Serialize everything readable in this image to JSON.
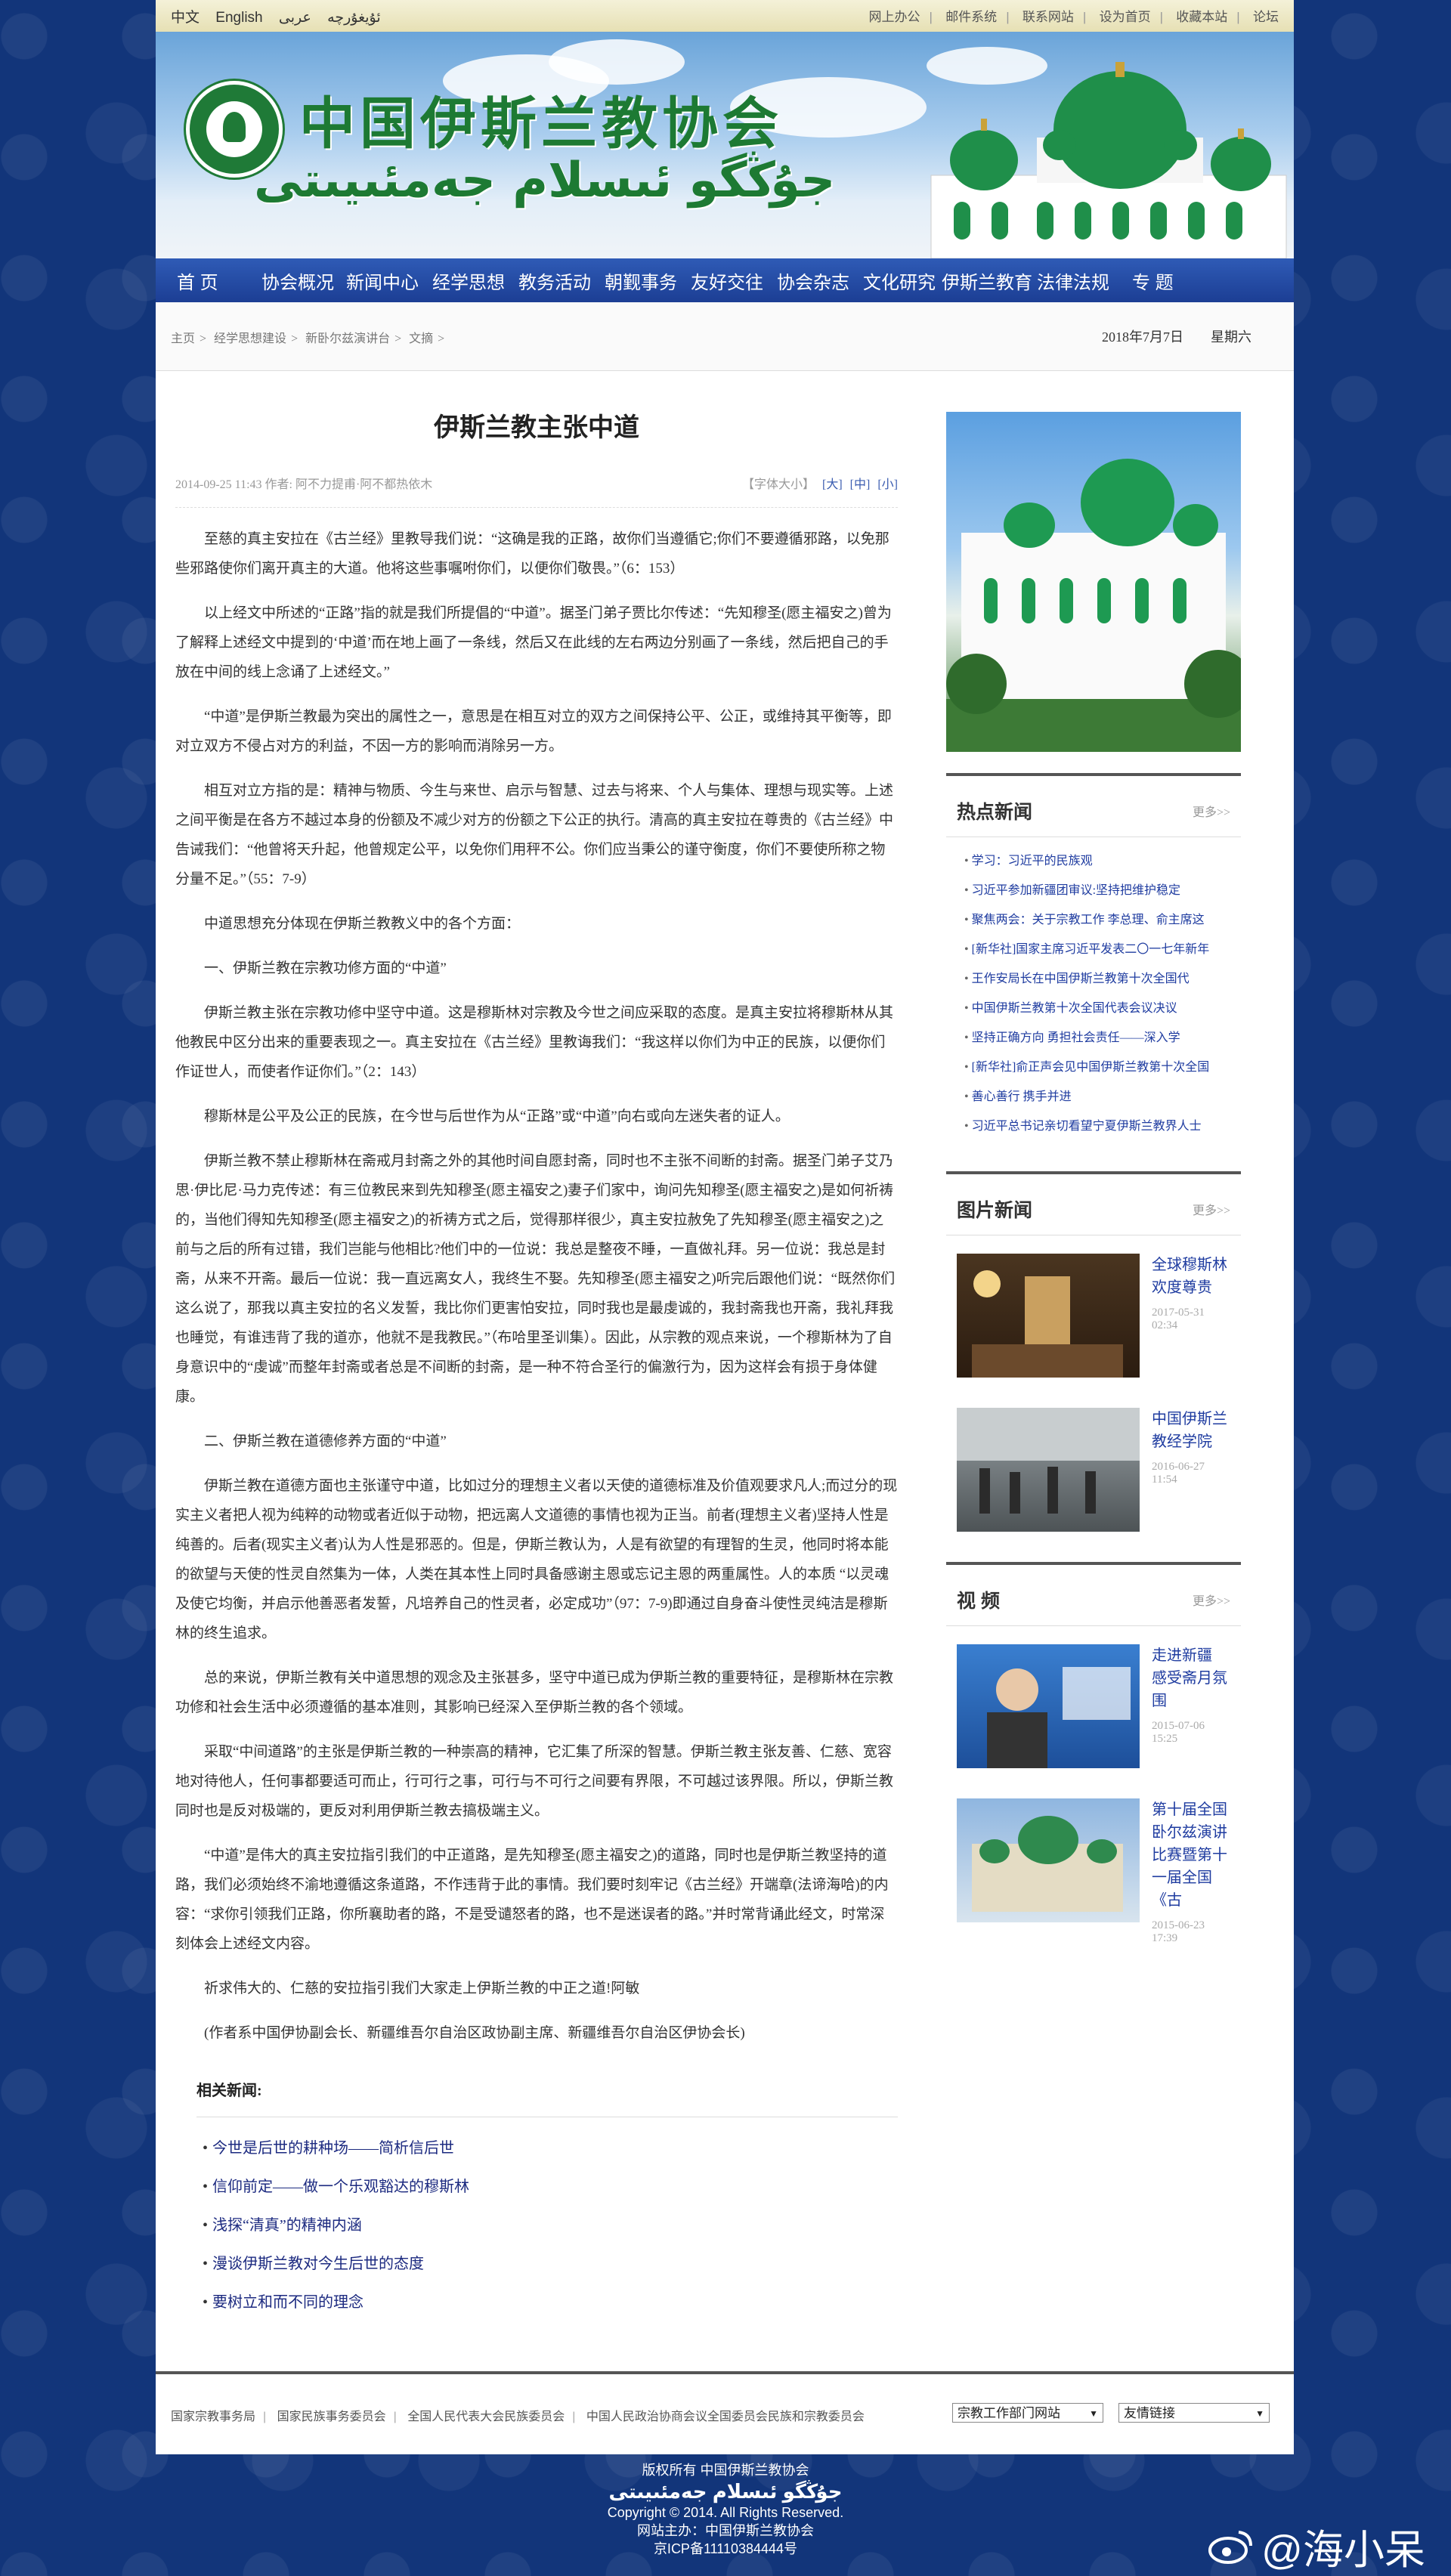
{
  "topbar": {
    "lang": [
      "中文",
      "English",
      "ئۇيغۇرچە",
      "عربى"
    ],
    "links": [
      "网上办公",
      "邮件系统",
      "联系网站",
      "设为首页",
      "收藏本站",
      "论坛"
    ]
  },
  "banner": {
    "cn_title": "中国伊斯兰教协会",
    "ug_title": "جۇڭگو ئىسلام جەمئىيىتى"
  },
  "nav": [
    "首 页",
    "协会概况",
    "新闻中心",
    "经学思想",
    "教务活动",
    "朝觐事务",
    "友好交往",
    "协会杂志",
    "文化研究",
    "伊斯兰教育",
    "法律法规",
    "专 题"
  ],
  "breadcrumb": [
    "主页",
    "经学思想建设",
    "新卧尔兹演讲台",
    "文摘"
  ],
  "date": {
    "date": "2018年7月7日",
    "weekday": "星期六"
  },
  "article": {
    "title": "伊斯兰教主张中道",
    "meta_left": "2014-09-25 11:43 作者: 阿不力提甫·阿不都热依木",
    "size_label": "【字体大小】",
    "sizes": [
      "[大]",
      "[中]",
      "[小]"
    ],
    "paragraphs": [
      "至慈的真主安拉在《古兰经》里教导我们说：“这确是我的正路，故你们当遵循它;你们不要遵循邪路，以免那些邪路使你们离开真主的大道。他将这些事嘱咐你们，以便你们敬畏。”（6：153）",
      "以上经文中所述的“正路”指的就是我们所提倡的“中道”。据圣门弟子贾比尔传述：“先知穆圣(愿主福安之)曾为了解释上述经文中提到的‘中道’而在地上画了一条线，然后又在此线的左右两边分别画了一条线，然后把自己的手放在中间的线上念诵了上述经文。”",
      "“中道”是伊斯兰教最为突出的属性之一，意思是在相互对立的双方之间保持公平、公正，或维持其平衡等，即对立双方不侵占对方的利益，不因一方的影响而消除另一方。",
      "相互对立方指的是：精神与物质、今生与来世、启示与智慧、过去与将来、个人与集体、理想与现实等。上述之间平衡是在各方不越过本身的份额及不减少对方的份额之下公正的执行。清高的真主安拉在尊贵的《古兰经》中告诫我们：“他曾将天升起，他曾规定公平，以免你们用秤不公。你们应当秉公的谨守衡度，你们不要使所称之物分量不足。”（55：7-9）",
      "中道思想充分体现在伊斯兰教教义中的各个方面：",
      "一、伊斯兰教在宗教功修方面的“中道”",
      "伊斯兰教主张在宗教功修中坚守中道。这是穆斯林对宗教及今世之间应采取的态度。是真主安拉将穆斯林从其他教民中区分出来的重要表现之一。真主安拉在《古兰经》里教诲我们：“我这样以你们为中正的民族，以便你们作证世人，而使者作证你们。”（2：143）",
      "穆斯林是公平及公正的民族，在今世与后世作为从“正路”或“中道”向右或向左迷失者的证人。",
      "伊斯兰教不禁止穆斯林在斋戒月封斋之外的其他时间自愿封斋，同时也不主张不间断的封斋。据圣门弟子艾乃思·伊比尼·马力克传述：有三位教民来到先知穆圣(愿主福安之)妻子们家中，询问先知穆圣(愿主福安之)是如何祈祷的，当他们得知先知穆圣(愿主福安之)的祈祷方式之后，觉得那样很少，真主安拉赦免了先知穆圣(愿主福安之)之前与之后的所有过错，我们岂能与他相比?他们中的一位说：我总是整夜不睡，一直做礼拜。另一位说：我总是封斋，从来不开斋。最后一位说：我一直远离女人，我终生不娶。先知穆圣(愿主福安之)听完后跟他们说：“既然你们这么说了，那我以真主安拉的名义发誓，我比你们更害怕安拉，同时我也是最虔诚的，我封斋我也开斋，我礼拜我也睡觉，有谁违背了我的道亦，他就不是我教民。”（布哈里圣训集）。因此，从宗教的观点来说，一个穆斯林为了自身意识中的“虔诚”而整年封斋或者总是不间断的封斋，是一种不符合圣行的偏激行为，因为这样会有损于身体健康。",
      "二、伊斯兰教在道德修养方面的“中道”",
      "伊斯兰教在道德方面也主张谨守中道，比如过分的理想主义者以天使的道德标准及价值观要求凡人;而过分的现实主义者把人视为纯粹的动物或者近似于动物，把远离人文道德的事情也视为正当。前者(理想主义者)坚持人性是纯善的。后者(现实主义者)认为人性是邪恶的。但是，伊斯兰教认为，人是有欲望的有理智的生灵，他同时将本能的欲望与天使的性灵自然集为一体，人类在其本性上同时具备感谢主恩或忘记主恩的两重属性。人的本质 “以灵魂及使它均衡，并启示他善恶者发誓，凡培养自己的性灵者，必定成功”（97：7-9)即通过自身奋斗使性灵纯洁是穆斯林的终生追求。",
      "总的来说，伊斯兰教有关中道思想的观念及主张甚多，坚守中道已成为伊斯兰教的重要特征，是穆斯林在宗教功修和社会生活中必须遵循的基本准则，其影响已经深入至伊斯兰教的各个领域。",
      "采取“中间道路”的主张是伊斯兰教的一种崇高的精神，它汇集了所深的智慧。伊斯兰教主张友善、仁慈、宽容地对待他人，任何事都要适可而止，行可行之事，可行与不可行之间要有界限，不可越过该界限。所以，伊斯兰教同时也是反对极端的，更反对利用伊斯兰教去搞极端主义。",
      "“中道”是伟大的真主安拉指引我们的中正道路，是先知穆圣(愿主福安之)的道路，同时也是伊斯兰教坚持的道路，我们必须始终不渝地遵循这条道路，不作违背于此的事情。我们要时刻牢记《古兰经》开端章(法谛海哈)的内容：“求你引领我们正路，你所襄助者的路，不是受谴怒者的路，也不是迷误者的路。”并时常背诵此经文，时常深刻体会上述经文内容。",
      "祈求伟大的、仁慈的安拉指引我们大家走上伊斯兰教的中正之道!阿敏",
      "(作者系中国伊协副会长、新疆维吾尔自治区政协副主席、新疆维吾尔自治区伊协会长)"
    ],
    "related_title": "相关新闻:",
    "related": [
      "今世是后世的耕种场——简析信后世",
      "信仰前定——做一个乐观豁达的穆斯林",
      "浅探“清真”的精神内涵",
      "漫谈伊斯兰教对今生后世的态度",
      "要树立和而不同的理念"
    ]
  },
  "sidebar": {
    "hot_title": "热点新闻",
    "more": "更多>>",
    "hot": [
      "学习：习近平的民族观",
      "习近平参加新疆团审议:坚持把维护稳定",
      "聚焦两会：关于宗教工作 李总理、俞主席这",
      "[新华社]国家主席习近平发表二〇一七年新年",
      "王作安局长在中国伊斯兰教第十次全国代",
      "中国伊斯兰教第十次全国代表会议决议",
      "坚持正确方向 勇担社会责任——深入学",
      "[新华社]俞正声会见中国伊斯兰教第十次全国",
      "善心善行 携手并进",
      "习近平总书记亲切看望宁夏伊斯兰教界人士"
    ],
    "pic_title": "图片新闻",
    "pics": [
      {
        "title": "全球穆斯林欢度尊贵",
        "date": "2017-05-31 02:34"
      },
      {
        "title": "中国伊斯兰教经学院",
        "date": "2016-06-27 11:54"
      }
    ],
    "video_title": "视 频",
    "videos": [
      {
        "title": "走进新疆 感受斋月氛围",
        "date": "2015-07-06 15:25"
      },
      {
        "title": "第十届全国卧尔兹演讲比赛暨第十一届全国《古",
        "date": "2015-06-23 17:39"
      }
    ]
  },
  "footer": {
    "links": [
      "国家宗教事务局",
      "国家民族事务委员会",
      "全国人民代表大会民族委员会",
      "中国人民政治协商会议全国委员会民族和宗教委员会"
    ],
    "select1": "宗教工作部门网站",
    "select2": "友情链接",
    "copyright1": "版权所有 中国伊斯兰教协会",
    "copyright_ug": "جۇڭگو ئىسلام جەمئىيىتى",
    "copyright2": "Copyright © 2014. All Rights Reserved.",
    "sponsor": "网站主办：中国伊斯兰教协会",
    "icp": "京ICP备11110384444号"
  },
  "watermark": "@海小呆"
}
